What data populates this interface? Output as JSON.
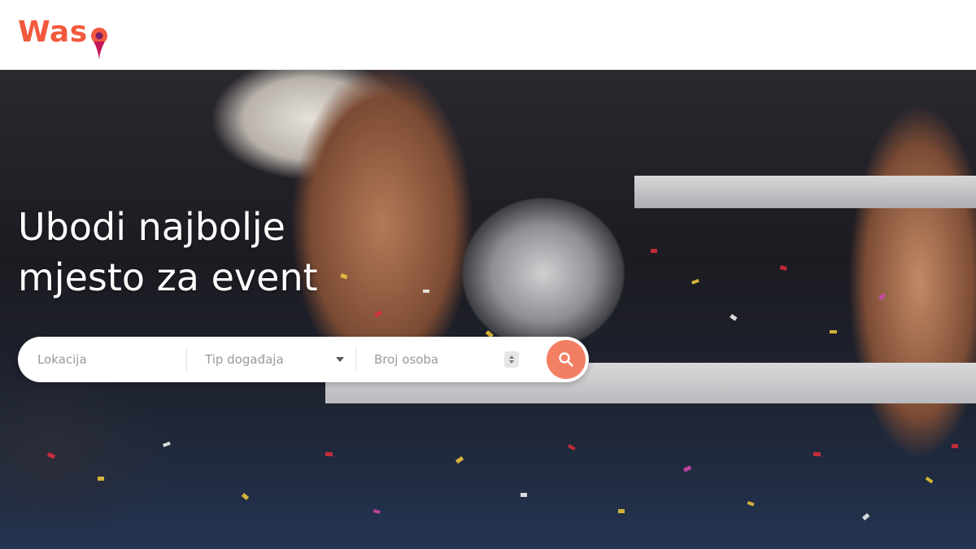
{
  "brand": {
    "name": "Wasp",
    "logo_text": "Was",
    "accent": "#f3593c"
  },
  "hero": {
    "headline_line1": "Ubodi najbolje",
    "headline_line2": "mjesto za event"
  },
  "search": {
    "location_placeholder": "Lokacija",
    "event_type_placeholder": "Tip događaja",
    "guests_placeholder": "Broj osoba",
    "button_color": "#f37f63",
    "button_icon": "search-icon"
  }
}
